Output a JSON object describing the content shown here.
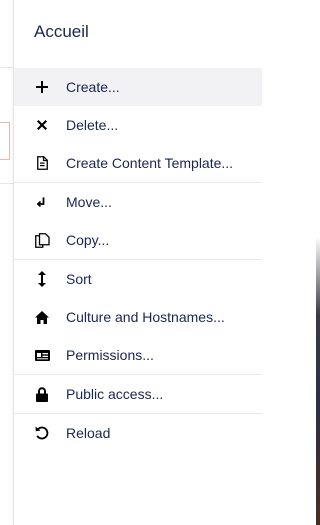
{
  "panel": {
    "title": "Accueil"
  },
  "menu": {
    "items": [
      {
        "label": "Create...",
        "icon": "plus-icon"
      },
      {
        "label": "Delete...",
        "icon": "delete-x-icon"
      },
      {
        "label": "Create Content Template...",
        "icon": "document-icon"
      },
      {
        "label": "Move...",
        "icon": "move-arrow-icon"
      },
      {
        "label": "Copy...",
        "icon": "copy-icon"
      },
      {
        "label": "Sort",
        "icon": "sort-arrows-icon"
      },
      {
        "label": "Culture and Hostnames...",
        "icon": "home-icon"
      },
      {
        "label": "Permissions...",
        "icon": "id-card-icon"
      },
      {
        "label": "Public access...",
        "icon": "lock-icon"
      },
      {
        "label": "Reload",
        "icon": "reload-icon"
      }
    ]
  },
  "colors": {
    "text": "#1b264f",
    "active_bg": "#f2f2f4",
    "separator": "#e9e9eb"
  }
}
